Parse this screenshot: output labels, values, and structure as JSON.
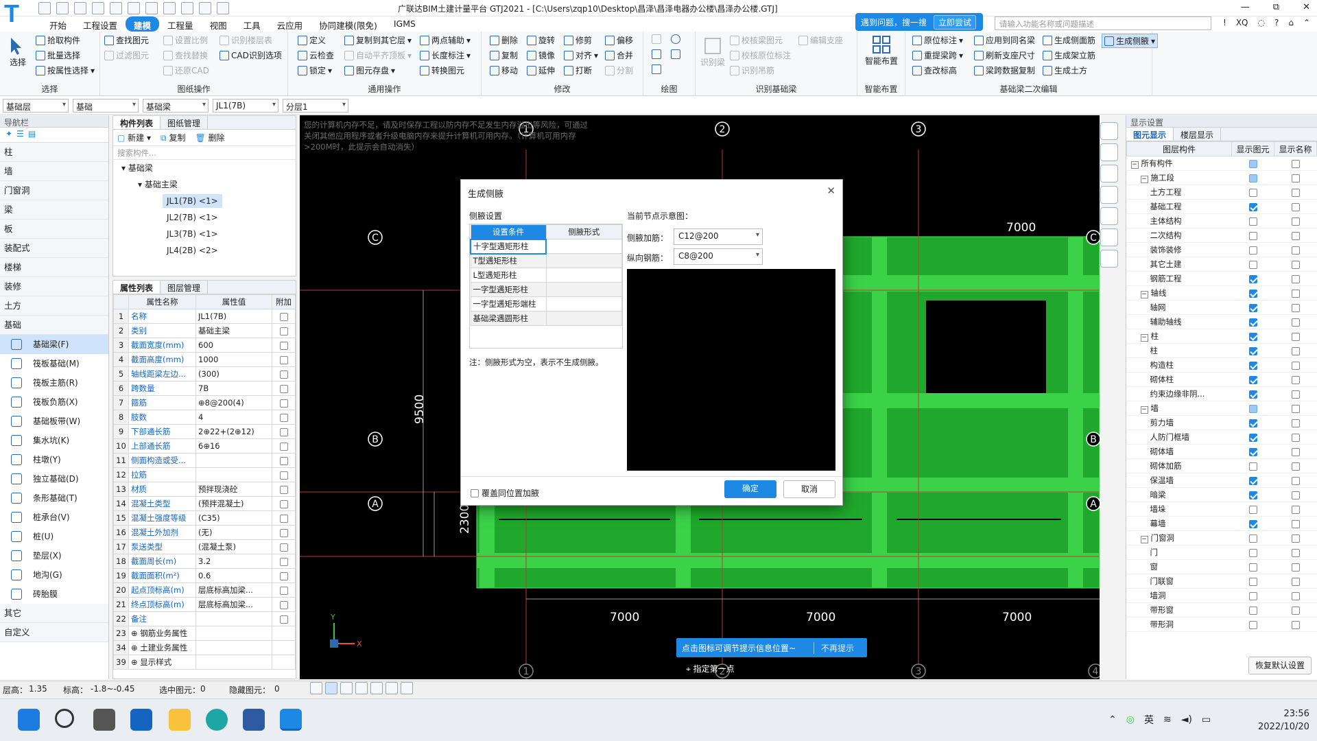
{
  "app": {
    "title": "广联达BIM土建计量平台 GTJ2021 - [C:\\Users\\zqp10\\Desktop\\昌泽\\昌泽电器办公楼\\昌泽办公楼.GTJ]",
    "logo": "T",
    "window_controls": [
      "—",
      "⧉",
      "✕"
    ]
  },
  "menu": {
    "items": [
      "开始",
      "工程设置",
      "建模",
      "工程量",
      "视图",
      "工具",
      "云应用",
      "协同建模(限免)",
      "IGMS"
    ],
    "active": "建模"
  },
  "help": {
    "text": "遇到问题，搜一搜",
    "try": "立即尝试",
    "search_placeholder": "请输入功能名称或问题描述",
    "user": "XQ",
    "icons": [
      "!",
      "◌",
      "?",
      "⌂",
      "⌃"
    ]
  },
  "ribbon": {
    "select": {
      "label": "选择",
      "pick": "拾取构件",
      "batch": "批量选择",
      "by_prop": "按属性选择",
      "group": "选择"
    },
    "drawing": {
      "find": "查找图元",
      "filter": "过滤图元",
      "set_scale": "设置比例",
      "restore_cad": "还原CAD",
      "find_replace": "查找替换",
      "identify_floor": "识别楼层表",
      "cad_options": "CAD识别选项",
      "group": "图纸操作"
    },
    "common": {
      "define": "定义",
      "copy_to_floor": "复制到其它层",
      "two_point_axis": "两点辅助",
      "cloud_check": "云检查",
      "auto_slab": "自动平齐顶板",
      "length_dim": "长度标注",
      "lock": "锁定",
      "save_elem": "图元存盘",
      "convert": "转换图元",
      "group": "通用操作"
    },
    "modify": {
      "delete": "删除",
      "rotate": "旋转",
      "trim": "修剪",
      "offset": "偏移",
      "copy": "复制",
      "mirror": "镜像",
      "align": "对齐",
      "merge": "合并",
      "move": "移动",
      "extend": "延伸",
      "break": "打断",
      "split": "分割",
      "group": "修改"
    },
    "draw": {
      "group": "绘图"
    },
    "identify": {
      "identify_beam": "识别梁",
      "check_beam": "校核梁图元",
      "check_origin": "校核原位标注",
      "identify_comp": "识别吊筋",
      "edit_support": "编辑支座",
      "group": "识别基础梁"
    },
    "smart": {
      "label": "智能布置",
      "group": "智能布置"
    },
    "second_edit": {
      "origin_mark": "原位标注",
      "apply_same": "应用到同名梁",
      "gen_side": "生成侧面筋",
      "gen_side2": "生成侧腋",
      "reextract": "重提梁跨",
      "refresh": "刷新支座尺寸",
      "gen_rack": "生成架立筋",
      "view_mark": "查改标高",
      "span_copy": "梁跨数据复制",
      "gen_earth": "生成土方",
      "group": "基础梁二次编辑"
    }
  },
  "combos": [
    "基础层",
    "基础",
    "基础梁",
    "JL1(7B)",
    "分层1"
  ],
  "nav": {
    "title": "导航栏",
    "categories_top": [
      "柱",
      "墙",
      "门窗洞",
      "梁",
      "板",
      "装配式",
      "楼梯",
      "装修",
      "土方",
      "基础"
    ],
    "subitems": [
      "基础梁(F)",
      "筏板基础(M)",
      "筏板主筋(R)",
      "筏板负筋(X)",
      "基础板带(W)",
      "集水坑(K)",
      "柱墩(Y)",
      "独立基础(D)",
      "条形基础(T)",
      "桩承台(V)",
      "桩(U)",
      "垫层(X)",
      "地沟(G)",
      "砖胎膜"
    ],
    "selected": "基础梁(F)",
    "categories_bottom": [
      "其它",
      "自定义"
    ]
  },
  "complist": {
    "tabs": [
      "构件列表",
      "图纸管理"
    ],
    "new": "新建",
    "copy": "复制",
    "delete": "删除",
    "search_placeholder": "搜索构件...",
    "tree": {
      "root": "基础梁",
      "group": "基础主梁",
      "items": [
        "JL1(7B) <1>",
        "JL2(7B) <1>",
        "JL3(7B) <1>",
        "JL4(2B) <2>"
      ],
      "selected": "JL1(7B) <1>"
    }
  },
  "props": {
    "tabs": [
      "属性列表",
      "图层管理"
    ],
    "headers": [
      "属性名称",
      "属性值",
      "附加"
    ],
    "rows": [
      {
        "n": "1",
        "name": "名称",
        "value": "JL1(7B)",
        "cb": false
      },
      {
        "n": "2",
        "name": "类别",
        "value": "基础主梁",
        "cb": true
      },
      {
        "n": "3",
        "name": "截面宽度(mm)",
        "value": "600",
        "cb": true
      },
      {
        "n": "4",
        "name": "截面高度(mm)",
        "value": "1000",
        "cb": true
      },
      {
        "n": "5",
        "name": "轴线距梁左边...",
        "value": "(300)",
        "cb": true
      },
      {
        "n": "6",
        "name": "跨数量",
        "value": "7B",
        "cb": true
      },
      {
        "n": "7",
        "name": "箍筋",
        "value": "⊕8@200(4)",
        "cb": true
      },
      {
        "n": "8",
        "name": "肢数",
        "value": "4",
        "cb": false
      },
      {
        "n": "9",
        "name": "下部通长筋",
        "value": "2⊕22+(2⊕12)",
        "cb": true
      },
      {
        "n": "10",
        "name": "上部通长筋",
        "value": "6⊕16",
        "cb": true
      },
      {
        "n": "11",
        "name": "侧面构造或受...",
        "value": "",
        "cb": true
      },
      {
        "n": "12",
        "name": "拉筋",
        "value": "",
        "cb": true
      },
      {
        "n": "13",
        "name": "材质",
        "value": "预拌现浇砼",
        "cb": true
      },
      {
        "n": "14",
        "name": "混凝土类型",
        "value": "(预拌混凝土)",
        "cb": true
      },
      {
        "n": "15",
        "name": "混凝土强度等级",
        "value": "(C35)",
        "cb": true
      },
      {
        "n": "16",
        "name": "混凝土外加剂",
        "value": "(无)",
        "cb": false
      },
      {
        "n": "17",
        "name": "泵送类型",
        "value": "(混凝土泵)",
        "cb": false
      },
      {
        "n": "18",
        "name": "截面周长(m)",
        "value": "3.2",
        "cb": true
      },
      {
        "n": "19",
        "name": "截面面积(m²)",
        "value": "0.6",
        "cb": true
      },
      {
        "n": "20",
        "name": "起点顶标高(m)",
        "value": "层底标高加梁...",
        "cb": true
      },
      {
        "n": "21",
        "name": "终点顶标高(m)",
        "value": "层底标高加梁...",
        "cb": true
      },
      {
        "n": "22",
        "name": "备注",
        "value": "",
        "cb": true
      },
      {
        "n": "23",
        "name": "⊕ 钢筋业务属性",
        "value": "",
        "cb": null
      },
      {
        "n": "34",
        "name": "⊕ 土建业务属性",
        "value": "",
        "cb": null
      },
      {
        "n": "39",
        "name": "⊕ 显示样式",
        "value": "",
        "cb": null
      }
    ]
  },
  "canvas": {
    "warning": "您的计算机内存不足，请及时保存工程以防内存不足发生内存溢出等风险，可通过关闭其他应用程序或者升级电脑内存来提升计算机可用内存。（计算机可用内存>200M时，此提示会自动消失）",
    "axes_top": [
      "1",
      "2",
      "3"
    ],
    "axes_bottom": [
      "1",
      "2",
      "3",
      "4"
    ],
    "axes_left": [
      "C",
      "B",
      "A"
    ],
    "axes_right": [
      "C",
      "B",
      "A"
    ],
    "dims": {
      "top": "7000",
      "left_big": "9500",
      "left_small": "2300",
      "bottom": [
        "7000",
        "7000",
        "7000"
      ]
    },
    "ucs": {
      "x": "X",
      "y": "Y"
    },
    "tip": "点击图标可调节提示信息位置~",
    "tip_dismiss": "不再提示",
    "cmd": "指定第一点"
  },
  "dialog": {
    "title": "生成侧腋",
    "section": "侧腋设置",
    "headers": [
      "设置条件",
      "侧腋形式"
    ],
    "rows": [
      "十字型遇矩形柱",
      "T型遇矩形柱",
      "L型遇矩形柱",
      "一字型遇矩形柱",
      "一字型遇矩形端柱",
      "基础梁遇圆形柱"
    ],
    "note": "注：侧腋形式为空，表示不生成侧腋。",
    "preview_label": "当前节点示意图：",
    "side_label": "侧腋加筋：",
    "side_value": "C12@200",
    "long_label": "纵向钢筋：",
    "long_value": "C8@200",
    "overwrite": "覆盖同位置加腋",
    "ok": "确定",
    "cancel": "取消",
    "close": "✕"
  },
  "display": {
    "title": "显示设置",
    "tabs": [
      "图元显示",
      "楼层显示"
    ],
    "headers": [
      "图层构件",
      "显示图元",
      "显示名称"
    ],
    "rows": [
      {
        "t": "所有构件",
        "lvl": 0,
        "exp": "−",
        "s": "part",
        "n": "off"
      },
      {
        "t": "施工段",
        "lvl": 1,
        "exp": "−",
        "s": "part",
        "n": "off"
      },
      {
        "t": "土方工程",
        "lvl": 2,
        "s": "off",
        "n": "off"
      },
      {
        "t": "基础工程",
        "lvl": 2,
        "s": "on",
        "n": "off"
      },
      {
        "t": "主体结构",
        "lvl": 2,
        "s": "off",
        "n": "off"
      },
      {
        "t": "二次结构",
        "lvl": 2,
        "s": "off",
        "n": "off"
      },
      {
        "t": "装饰装修",
        "lvl": 2,
        "s": "off",
        "n": "off"
      },
      {
        "t": "其它土建",
        "lvl": 2,
        "s": "off",
        "n": "off"
      },
      {
        "t": "钢筋工程",
        "lvl": 2,
        "s": "on",
        "n": "off"
      },
      {
        "t": "轴线",
        "lvl": 1,
        "exp": "−",
        "s": "on",
        "n": "off"
      },
      {
        "t": "轴网",
        "lvl": 2,
        "s": "on",
        "n": "off"
      },
      {
        "t": "辅助轴线",
        "lvl": 2,
        "s": "on",
        "n": "off"
      },
      {
        "t": "柱",
        "lvl": 1,
        "exp": "−",
        "s": "on",
        "n": "off"
      },
      {
        "t": "柱",
        "lvl": 2,
        "s": "on",
        "n": "off"
      },
      {
        "t": "构造柱",
        "lvl": 2,
        "s": "on",
        "n": "off"
      },
      {
        "t": "砌体柱",
        "lvl": 2,
        "s": "on",
        "n": "off"
      },
      {
        "t": "约束边缘非阴...",
        "lvl": 2,
        "s": "on",
        "n": "off"
      },
      {
        "t": "墙",
        "lvl": 1,
        "exp": "−",
        "s": "part",
        "n": "off"
      },
      {
        "t": "剪力墙",
        "lvl": 2,
        "s": "on",
        "n": "off"
      },
      {
        "t": "人防门框墙",
        "lvl": 2,
        "s": "on",
        "n": "off"
      },
      {
        "t": "砌体墙",
        "lvl": 2,
        "s": "on",
        "n": "off"
      },
      {
        "t": "砌体加筋",
        "lvl": 2,
        "s": "off",
        "n": "off"
      },
      {
        "t": "保温墙",
        "lvl": 2,
        "s": "on",
        "n": "off"
      },
      {
        "t": "暗梁",
        "lvl": 2,
        "s": "on",
        "n": "off"
      },
      {
        "t": "墙垛",
        "lvl": 2,
        "s": "off",
        "n": "off"
      },
      {
        "t": "幕墙",
        "lvl": 2,
        "s": "on",
        "n": "off"
      },
      {
        "t": "门窗洞",
        "lvl": 1,
        "exp": "−",
        "s": "off",
        "n": "off"
      },
      {
        "t": "门",
        "lvl": 2,
        "s": "off",
        "n": "off"
      },
      {
        "t": "窗",
        "lvl": 2,
        "s": "off",
        "n": "off"
      },
      {
        "t": "门联窗",
        "lvl": 2,
        "s": "off",
        "n": "off"
      },
      {
        "t": "墙洞",
        "lvl": 2,
        "s": "off",
        "n": "off"
      },
      {
        "t": "带形窗",
        "lvl": 2,
        "s": "off",
        "n": "off"
      },
      {
        "t": "带形洞",
        "lvl": 2,
        "s": "off",
        "n": "off"
      }
    ],
    "reset": "恢复默认设置"
  },
  "status": {
    "floor_h": "层高：",
    "floor_h_v": "1.35",
    "elev": "标高：",
    "elev_v": "-1.8~-0.45",
    "selected": "选中图元：",
    "selected_v": "0",
    "hidden": "隐藏图元：",
    "hidden_v": "0"
  },
  "taskbar": {
    "tray_lang": "英",
    "time": "23:56",
    "date": "2022/10/20",
    "tray_icons": [
      "⌃",
      "◎",
      "wifi",
      "speaker",
      "battery"
    ]
  }
}
